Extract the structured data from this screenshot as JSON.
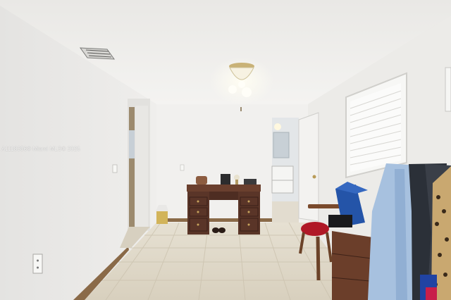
{
  "watermark": {
    "text": "A1118356© Miami MLS© 2025"
  },
  "colors": {
    "wall": "#eeedeb",
    "ceiling": "#f0efec",
    "floor_tile": "#ddd6c6",
    "desk_wood": "#5a3528",
    "chair_seat": "#b01826",
    "baseboard": "#8a6a48"
  }
}
